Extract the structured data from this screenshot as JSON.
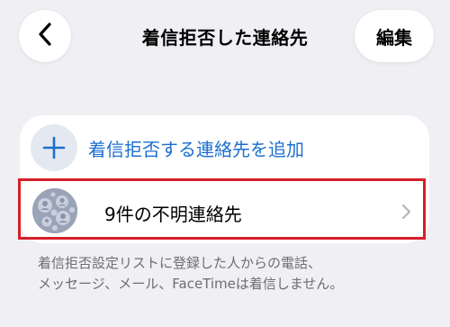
{
  "header": {
    "title": "着信拒否した連絡先",
    "edit_label": "編集",
    "back_icon": "chevron-left-icon"
  },
  "list": {
    "add_row": {
      "label": "着信拒否する連絡先を追加",
      "icon": "plus-icon"
    },
    "unknown_row": {
      "label": "9件の不明連絡先",
      "icon": "group-avatar-icon",
      "trailing_icon": "chevron-right-icon"
    }
  },
  "footer": {
    "line1": "着信拒否設定リストに登録した人からの電話、",
    "line2": "メッセージ、メール、FaceTimeは着信しません。"
  },
  "colors": {
    "background": "#efeff4",
    "accent": "#1e6fcf",
    "highlight_border": "#d61f27"
  }
}
